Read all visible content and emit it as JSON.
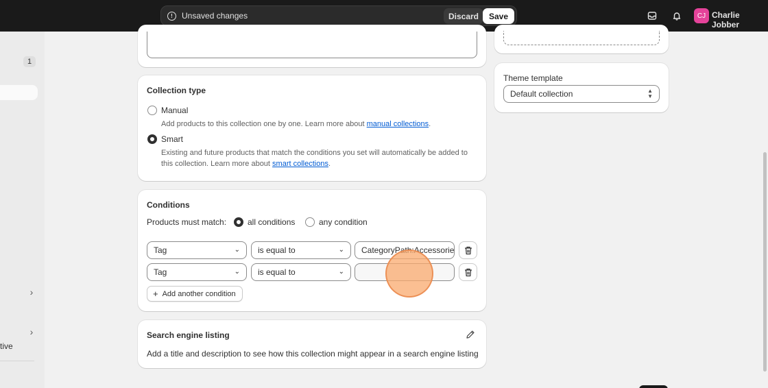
{
  "topbar": {
    "unsaved_label": "Unsaved changes",
    "discard_label": "Discard",
    "save_label": "Save",
    "avatar_initials": "CJ",
    "user_name": "Charlie Jobber"
  },
  "sidebar": {
    "badge_count": "1",
    "partial_item_label": "tive"
  },
  "collection_type": {
    "title": "Collection type",
    "manual_label": "Manual",
    "manual_desc_prefix": "Add products to this collection one by one. Learn more about ",
    "manual_link": "manual collections",
    "manual_desc_suffix": ".",
    "smart_label": "Smart",
    "smart_desc_prefix": "Existing and future products that match the conditions you set will automatically be added to this collection. Learn more about ",
    "smart_link": "smart collections",
    "smart_desc_suffix": ".",
    "selected": "Smart"
  },
  "conditions": {
    "title": "Conditions",
    "match_label": "Products must match:",
    "all_label": "all conditions",
    "any_label": "any condition",
    "selected": "all conditions",
    "rows": [
      {
        "field": "Tag",
        "operator": "is equal to",
        "value": "CategoryPath:Accessorie"
      },
      {
        "field": "Tag",
        "operator": "is equal to",
        "value": ""
      }
    ],
    "add_label": "Add another condition"
  },
  "seo": {
    "title": "Search engine listing",
    "description": "Add a title and description to see how this collection might appear in a search engine listing"
  },
  "theme": {
    "label": "Theme template",
    "selected": "Default collection"
  },
  "colors": {
    "topbar": "#1a1a1a",
    "link": "#005bd3",
    "avatar": "#e5439a",
    "click_indicator": "#faaa6e"
  }
}
